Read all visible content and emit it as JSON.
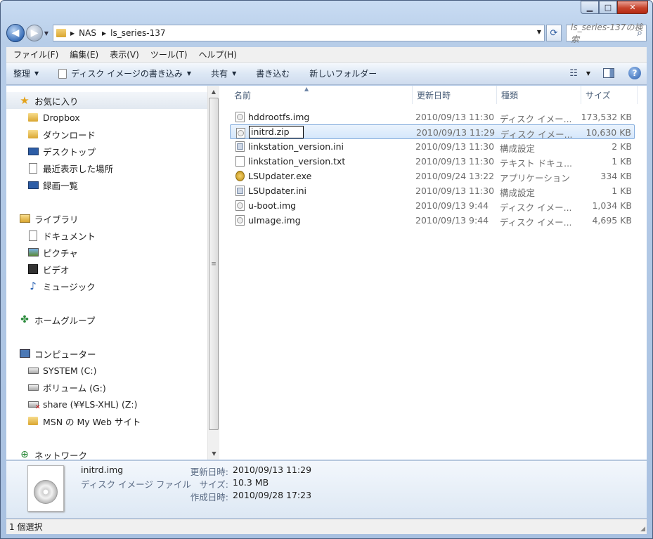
{
  "window": {
    "controls": {
      "minimize": "▁",
      "maximize": "□",
      "close": "✕"
    }
  },
  "address": {
    "breadcrumb": [
      "NAS",
      "ls_series-137"
    ],
    "search_placeholder": "ls_series-137の検索"
  },
  "menubar": [
    "ファイル(F)",
    "編集(E)",
    "表示(V)",
    "ツール(T)",
    "ヘルプ(H)"
  ],
  "toolbar": {
    "organize": "整理",
    "burn_image": "ディスク イメージの書き込み",
    "share": "共有",
    "burn": "書き込む",
    "new_folder": "新しいフォルダー"
  },
  "navpane": {
    "favorites": {
      "header": "お気に入り",
      "items": [
        "Dropbox",
        "ダウンロード",
        "デスクトップ",
        "最近表示した場所",
        "録画一覧"
      ]
    },
    "libraries": {
      "header": "ライブラリ",
      "items": [
        "ドキュメント",
        "ピクチャ",
        "ビデオ",
        "ミュージック"
      ]
    },
    "homegroup": {
      "header": "ホームグループ"
    },
    "computer": {
      "header": "コンピューター",
      "items": [
        "SYSTEM (C:)",
        "ボリューム (G:)",
        "share (¥¥LS-XHL) (Z:)",
        "MSN の My Web サイト"
      ]
    },
    "network": {
      "header": "ネットワーク"
    }
  },
  "columns": {
    "name": "名前",
    "date": "更新日時",
    "type": "種類",
    "size": "サイズ"
  },
  "files": [
    {
      "name": "hddrootfs.img",
      "date": "2010/09/13 11:30",
      "type": "ディスク イメー...",
      "size": "173,532 KB",
      "icon": "disc"
    },
    {
      "name": "initrd.zip",
      "date": "2010/09/13 11:29",
      "type": "ディスク イメー...",
      "size": "10,630 KB",
      "icon": "disc",
      "selected": true,
      "renaming": true
    },
    {
      "name": "linkstation_version.ini",
      "date": "2010/09/13 11:30",
      "type": "構成設定",
      "size": "2 KB",
      "icon": "cfg"
    },
    {
      "name": "linkstation_version.txt",
      "date": "2010/09/13 11:30",
      "type": "テキスト ドキュ...",
      "size": "1 KB",
      "icon": "txt"
    },
    {
      "name": "LSUpdater.exe",
      "date": "2010/09/24 13:22",
      "type": "アプリケーション",
      "size": "334 KB",
      "icon": "exe"
    },
    {
      "name": "LSUpdater.ini",
      "date": "2010/09/13 11:30",
      "type": "構成設定",
      "size": "1 KB",
      "icon": "cfg"
    },
    {
      "name": "u-boot.img",
      "date": "2010/09/13 9:44",
      "type": "ディスク イメー...",
      "size": "1,034 KB",
      "icon": "disc"
    },
    {
      "name": "uImage.img",
      "date": "2010/09/13 9:44",
      "type": "ディスク イメー...",
      "size": "4,695 KB",
      "icon": "disc"
    }
  ],
  "details": {
    "name": "initrd.img",
    "type": "ディスク イメージ ファイル",
    "modified_label": "更新日時:",
    "modified": "2010/09/13 11:29",
    "size_label": "サイズ:",
    "size": "10.3 MB",
    "created_label": "作成日時:",
    "created": "2010/09/28 17:23"
  },
  "status": "1 個選択"
}
